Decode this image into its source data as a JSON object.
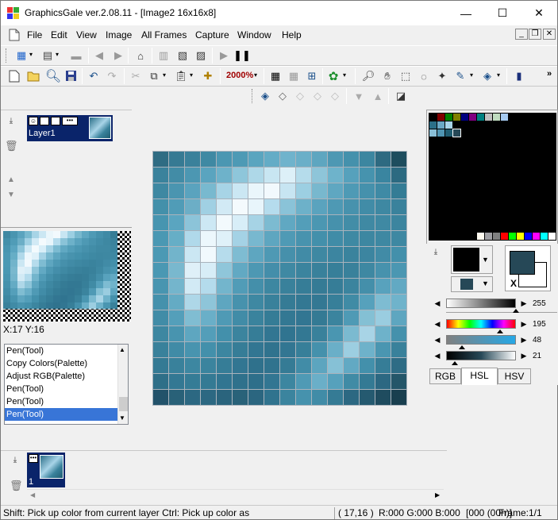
{
  "window": {
    "title": "GraphicsGale ver.2.08.11 - [Image2 16x16x8]",
    "minimize": "—",
    "maximize": "☐",
    "close": "✕"
  },
  "menu": {
    "items": [
      "File",
      "Edit",
      "View",
      "Image",
      "All Frames",
      "Capture",
      "Window",
      "Help"
    ],
    "mdi": [
      "_",
      "❐",
      "✕"
    ]
  },
  "toolbar": {
    "zoom": "2000%"
  },
  "layers": {
    "items": [
      {
        "name": "Layer1"
      }
    ]
  },
  "coords": {
    "text": "X:17 Y:16"
  },
  "history": {
    "items": [
      "Pen(Tool)",
      "Copy Colors(Palette)",
      "Adjust RGB(Palette)",
      "Pen(Tool)",
      "Pen(Tool)",
      "Pen(Tool)"
    ],
    "selected": 5
  },
  "frames": {
    "items": [
      {
        "number": "1"
      }
    ]
  },
  "color": {
    "primary": "#000000",
    "secondary_display": "#264857",
    "swap_label": "X",
    "sliders": [
      {
        "label": "255",
        "value": 255
      },
      {
        "label": "195",
        "value": 195
      },
      {
        "label": "48",
        "value": 48
      },
      {
        "label": "21",
        "value": 21
      }
    ]
  },
  "tabs": {
    "items": [
      "RGB",
      "HSL",
      "HSV"
    ],
    "active": 1
  },
  "status": {
    "hint": "Shift: Pick up color from current layer  Ctrl: Pick up color as",
    "position": "( 17,16 )",
    "rgb": "R:000 G:000 B:000",
    "index": "[000 (00h)]",
    "frame": "Frame:1/1"
  },
  "palette_colors": {
    "row0": [
      "#000000",
      "#800000",
      "#008000",
      "#808000",
      "#000080",
      "#800080",
      "#008080",
      "#c0c0c0",
      "#c0dcc0",
      "#a6caf0",
      "#000000",
      "#000000",
      "#000000",
      "#000000",
      "#000000",
      "#000000"
    ],
    "row1": [
      "#2b6f88",
      "#6aa8c5",
      "#a8d4e8",
      "#000000",
      "#000000",
      "#000000",
      "#000000",
      "#000000",
      "#000000",
      "#000000",
      "#000000",
      "#000000",
      "#000000",
      "#000000",
      "#000000",
      "#000000"
    ],
    "row2": [
      "#8ac0d8",
      "#4f95b3",
      "#1f5d72",
      "#264857",
      "#000000",
      "#000000",
      "#000000",
      "#000000",
      "#000000",
      "#000000",
      "#000000",
      "#000000",
      "#000000",
      "#000000",
      "#000000",
      "#000000"
    ],
    "last": [
      "#fffbf0",
      "#a0a0a4",
      "#808080",
      "#ff0000",
      "#00ff00",
      "#ffff00",
      "#0000ff",
      "#ff00ff",
      "#00ffff",
      "#ffffff"
    ]
  },
  "image_pixels": [
    [
      "#2f6c83",
      "#367a93",
      "#3a819b",
      "#3f89a3",
      "#4b97b2",
      "#4e9ab5",
      "#5aa5bf",
      "#64acc6",
      "#6fb3cc",
      "#6aafc8",
      "#5ea6c0",
      "#4e98b3",
      "#4591ac",
      "#3c86a0",
      "#2e6a81",
      "#1e4d5e"
    ],
    [
      "#3a829c",
      "#428ca6",
      "#4c97b2",
      "#5aa4bf",
      "#6eb2ca",
      "#8ec6da",
      "#aed8e8",
      "#c8e6f2",
      "#ddf0f8",
      "#b5dceb",
      "#8ec5d9",
      "#6eb3cb",
      "#56a1bc",
      "#4693ae",
      "#3a85a0",
      "#2c6a81"
    ],
    [
      "#3e88a2",
      "#4a95b0",
      "#5aa3be",
      "#78b9cf",
      "#a7d4e6",
      "#cbe7f3",
      "#eaf6fb",
      "#f2f9fd",
      "#c7e5f2",
      "#9ccfe2",
      "#78b8ce",
      "#5fa7c1",
      "#4e9ab5",
      "#4591ac",
      "#3f8aa5",
      "#347c95"
    ],
    [
      "#4390aa",
      "#509cb7",
      "#6caec6",
      "#a0d0e3",
      "#d2eaf5",
      "#f4fafd",
      "#e8f5fb",
      "#b5dced",
      "#8ac3d8",
      "#6db1c9",
      "#5aa3be",
      "#4e99b4",
      "#4792ad",
      "#418ca7",
      "#3e88a2",
      "#3a829c"
    ],
    [
      "#4795b0",
      "#5aa5c0",
      "#8cc4d9",
      "#cde8f4",
      "#f3fafd",
      "#d8eef8",
      "#a6d3e5",
      "#7cbbd1",
      "#60a8c2",
      "#539eb9",
      "#4b97b2",
      "#4691ac",
      "#428da7",
      "#3f89a3",
      "#3f89a3",
      "#3c859f"
    ],
    [
      "#4a98b3",
      "#66aec6",
      "#b0d9ea",
      "#ecf7fc",
      "#dff1f9",
      "#a4d2e5",
      "#78b8cf",
      "#5ea6c0",
      "#4f9ab5",
      "#4893ae",
      "#4390ab",
      "#408ca7",
      "#3e89a3",
      "#3d87a1",
      "#3e88a2",
      "#3e88a2"
    ],
    [
      "#4b99b4",
      "#72b4cb",
      "#cbe7f3",
      "#f1f9fd",
      "#b6dcec",
      "#7ebcd2",
      "#5ea6c0",
      "#4e99b4",
      "#4690ab",
      "#418ba6",
      "#3e88a2",
      "#3c85a0",
      "#3a839d",
      "#3c85a0",
      "#418ba6",
      "#4390ab"
    ],
    [
      "#4a98b3",
      "#79b8ce",
      "#dff0f8",
      "#d7edf7",
      "#8fc6da",
      "#62a9c3",
      "#4d98b3",
      "#448eaa",
      "#3f89a3",
      "#3b849e",
      "#39819b",
      "#377f99",
      "#39819b",
      "#3e88a2",
      "#4792ad",
      "#4b97b2"
    ],
    [
      "#4895b0",
      "#74b5cc",
      "#d2eaf5",
      "#b4dbec",
      "#73b5cc",
      "#519cb7",
      "#448faa",
      "#3d87a1",
      "#39819b",
      "#367d97",
      "#357b95",
      "#367d97",
      "#3b849e",
      "#448faa",
      "#58a2bd",
      "#62a9c3"
    ],
    [
      "#4591ac",
      "#64abc4",
      "#aed7e8",
      "#8ec5d9",
      "#5ea6c0",
      "#4792ad",
      "#3e88a2",
      "#39819b",
      "#357b95",
      "#337893",
      "#337893",
      "#377f99",
      "#408ba5",
      "#56a1bc",
      "#7ebcd2",
      "#6fb3cb"
    ],
    [
      "#418ca7",
      "#549fba",
      "#80bdd2",
      "#6aafc8",
      "#4f9ab5",
      "#418ca7",
      "#3a839d",
      "#357c96",
      "#337893",
      "#327692",
      "#347a94",
      "#3b849e",
      "#4f9ab5",
      "#84c0d4",
      "#9acde0",
      "#5ea6c0"
    ],
    [
      "#3d87a1",
      "#4894af",
      "#5ea6c0",
      "#539eb9",
      "#4390ab",
      "#3b849e",
      "#367d97",
      "#327692",
      "#307490",
      "#337893",
      "#39819b",
      "#4a96b1",
      "#7bbad0",
      "#a8d4e6",
      "#6eb2ca",
      "#4591ac"
    ],
    [
      "#39819b",
      "#408ba6",
      "#4894af",
      "#4390ab",
      "#3c86a0",
      "#367d97",
      "#327692",
      "#30738e",
      "#327692",
      "#377f99",
      "#4591ac",
      "#6aafc8",
      "#9ccee1",
      "#6eb2ca",
      "#4a96b1",
      "#39819b"
    ],
    [
      "#347a94",
      "#39819b",
      "#3d87a1",
      "#3b849e",
      "#367d97",
      "#327692",
      "#2f718c",
      "#30738e",
      "#357b95",
      "#418ca7",
      "#5ca5bf",
      "#86c1d6",
      "#62a9c3",
      "#4390ab",
      "#367d97",
      "#2e6c85"
    ],
    [
      "#2e6f88",
      "#337893",
      "#357c96",
      "#347a94",
      "#317591",
      "#2f718c",
      "#2e6f8a",
      "#327692",
      "#3c86a0",
      "#4f9ab5",
      "#6aafc8",
      "#56a1bc",
      "#408ba5",
      "#347a94",
      "#2c6882",
      "#245669"
    ],
    [
      "#22526a",
      "#296178",
      "#2c6882",
      "#2c6882",
      "#2a647d",
      "#296279",
      "#2b6680",
      "#30738e",
      "#3b849e",
      "#4692ad",
      "#418ca7",
      "#357b95",
      "#2c6882",
      "#255a70",
      "#1f4c5f",
      "#193f4f"
    ]
  ]
}
